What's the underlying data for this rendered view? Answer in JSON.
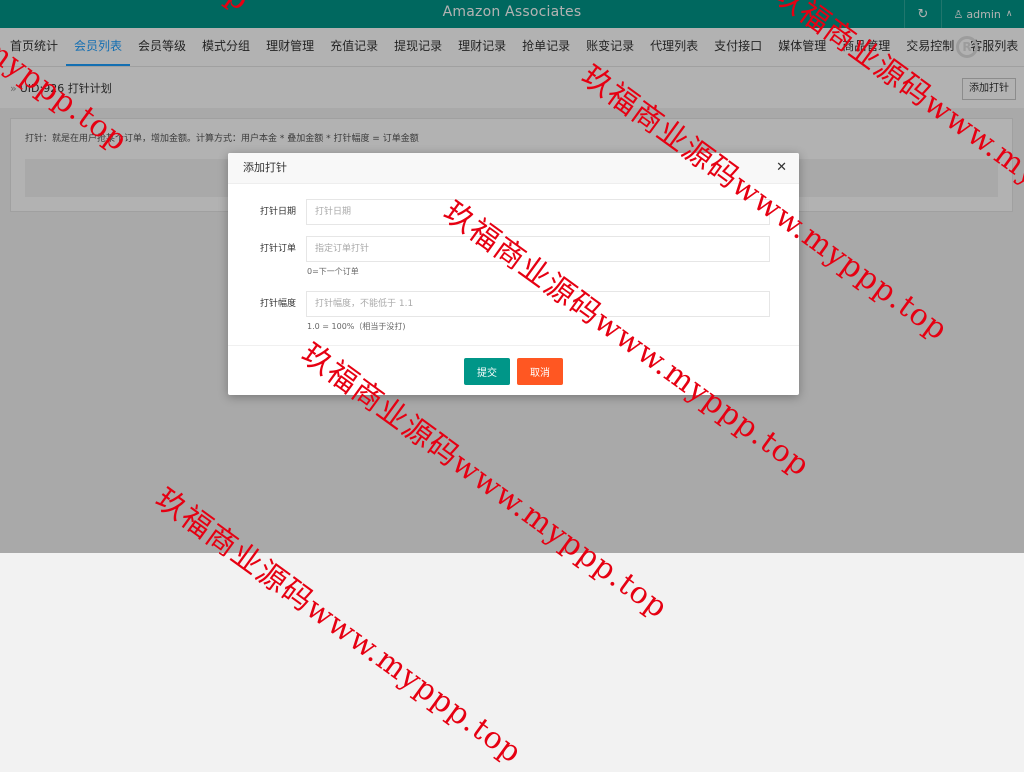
{
  "app": {
    "title": "Amazon Associates"
  },
  "header": {
    "refresh_icon": "refresh-icon",
    "user_icon": "user-icon",
    "user": "admin"
  },
  "nav": {
    "tabs": [
      {
        "label": "首页统计",
        "active": false
      },
      {
        "label": "会员列表",
        "active": true
      },
      {
        "label": "会员等级",
        "active": false
      },
      {
        "label": "模式分组",
        "active": false
      },
      {
        "label": "理财管理",
        "active": false
      },
      {
        "label": "充值记录",
        "active": false
      },
      {
        "label": "提现记录",
        "active": false
      },
      {
        "label": "理财记录",
        "active": false
      },
      {
        "label": "抢单记录",
        "active": false
      },
      {
        "label": "账变记录",
        "active": false
      },
      {
        "label": "代理列表",
        "active": false
      },
      {
        "label": "支付接口",
        "active": false
      },
      {
        "label": "媒体管理",
        "active": false
      },
      {
        "label": "商品管理",
        "active": false
      },
      {
        "label": "交易控制",
        "active": false
      },
      {
        "label": "客服列表",
        "active": false
      }
    ],
    "logo_text": "R"
  },
  "page": {
    "breadcrumb": "UID:926 打针计划",
    "add_button": "添加打针",
    "note": "打针：就是在用户抢某个订单，增加金额。计算方式：用户本金 * 叠加金额 * 打针幅度 = 订单金额"
  },
  "modal": {
    "title": "添加打针",
    "close_icon": "close-icon",
    "fields": [
      {
        "label": "打针日期",
        "placeholder": "打针日期",
        "value": "",
        "hint": ""
      },
      {
        "label": "打针订单",
        "placeholder": "指定订单打针",
        "value": "",
        "hint": "0=下一个订单"
      },
      {
        "label": "打针幅度",
        "placeholder": "打针幅度，不能低于 1.1",
        "value": "",
        "hint": "1.0 = 100%（相当于没打)"
      }
    ],
    "submit": "提交",
    "cancel": "取消"
  },
  "watermark": {
    "text_a": "玖福商业源码www.myppp.top",
    "text_b": "myppp.top",
    "text_c": "p"
  },
  "colors": {
    "brand": "#009688",
    "active_tab": "#1E9FFF",
    "cancel": "#FF5722",
    "watermark": "#e60012"
  }
}
